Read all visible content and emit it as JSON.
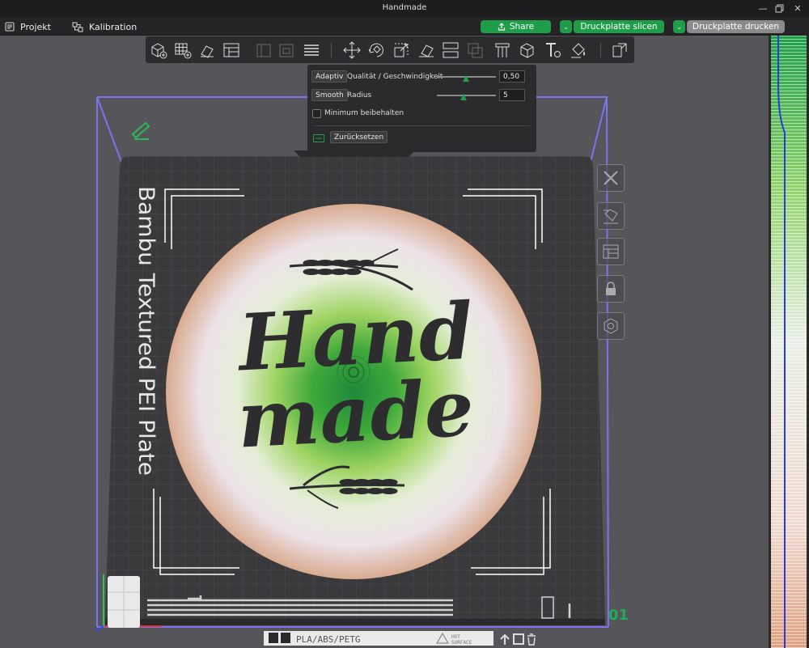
{
  "window": {
    "title": "Handmade"
  },
  "menu": {
    "project": "Projekt",
    "calibration": "Kalibration"
  },
  "actions": {
    "share": "Share",
    "slice": "Druckplatte slicen",
    "print": "Druckplatte drucken"
  },
  "icons": {
    "project": "project-icon",
    "calibration": "calibration-icon",
    "share": "share-icon",
    "minimize": "minimize-icon",
    "restore": "restore-icon",
    "close": "close-icon"
  },
  "adaptive_popup": {
    "adaptive_label": "Adaptiv",
    "quality_label": "Qualität / Geschwindigkeit",
    "quality_value": "0,50",
    "smooth_label": "Smooth",
    "radius_label": "Radius",
    "radius_value": "5",
    "keep_min_label": "Minimum beibehalten",
    "keep_min_checked": false,
    "reset_label": "Zurücksetzen"
  },
  "plate": {
    "bed_label": "Bambu Textured PEI Plate",
    "filament_label": "PLA/ABS/PETG",
    "hot_label_1": "HOT",
    "hot_label_2": "SURFACE",
    "plate_number": "01"
  },
  "model": {
    "text_line_1": "Hand",
    "text_line_2": "made"
  },
  "colors": {
    "accent": "#1f9e49",
    "bed_outline": "#7b74f0",
    "bed": "#3a3a3d",
    "disc_outer": "#e6b8a0",
    "disc_center": "#3ea83a"
  }
}
